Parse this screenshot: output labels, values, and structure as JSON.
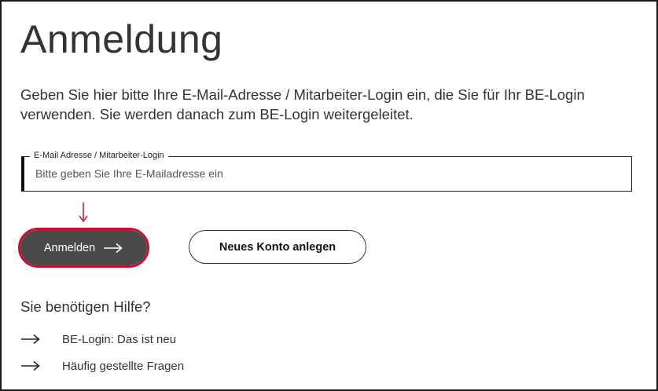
{
  "page": {
    "title": "Anmeldung",
    "intro": "Geben Sie hier bitte Ihre E-Mail-Adresse / Mitarbeiter-Login ein, die Sie für Ihr BE-Login verwenden. Sie werden danach zum BE-Login weitergeleitet."
  },
  "email_field": {
    "label": "E-Mail Adresse / Mitarbeiter-Login",
    "placeholder": "Bitte geben Sie Ihre E-Mailadresse ein",
    "value": ""
  },
  "buttons": {
    "login_label": "Anmelden",
    "login_icon": "arrow-right-icon",
    "new_account_label": "Neues Konto anlegen"
  },
  "help": {
    "heading": "Sie benötigen Hilfe?",
    "links": [
      {
        "label": "BE-Login: Das ist neu",
        "icon": "arrow-right-icon"
      },
      {
        "label": "Häufig gestellte Fragen",
        "icon": "arrow-right-icon"
      }
    ]
  },
  "colors": {
    "accent_red": "#c8102e",
    "primary_button_bg": "#4a4a4a",
    "text": "#333333"
  }
}
